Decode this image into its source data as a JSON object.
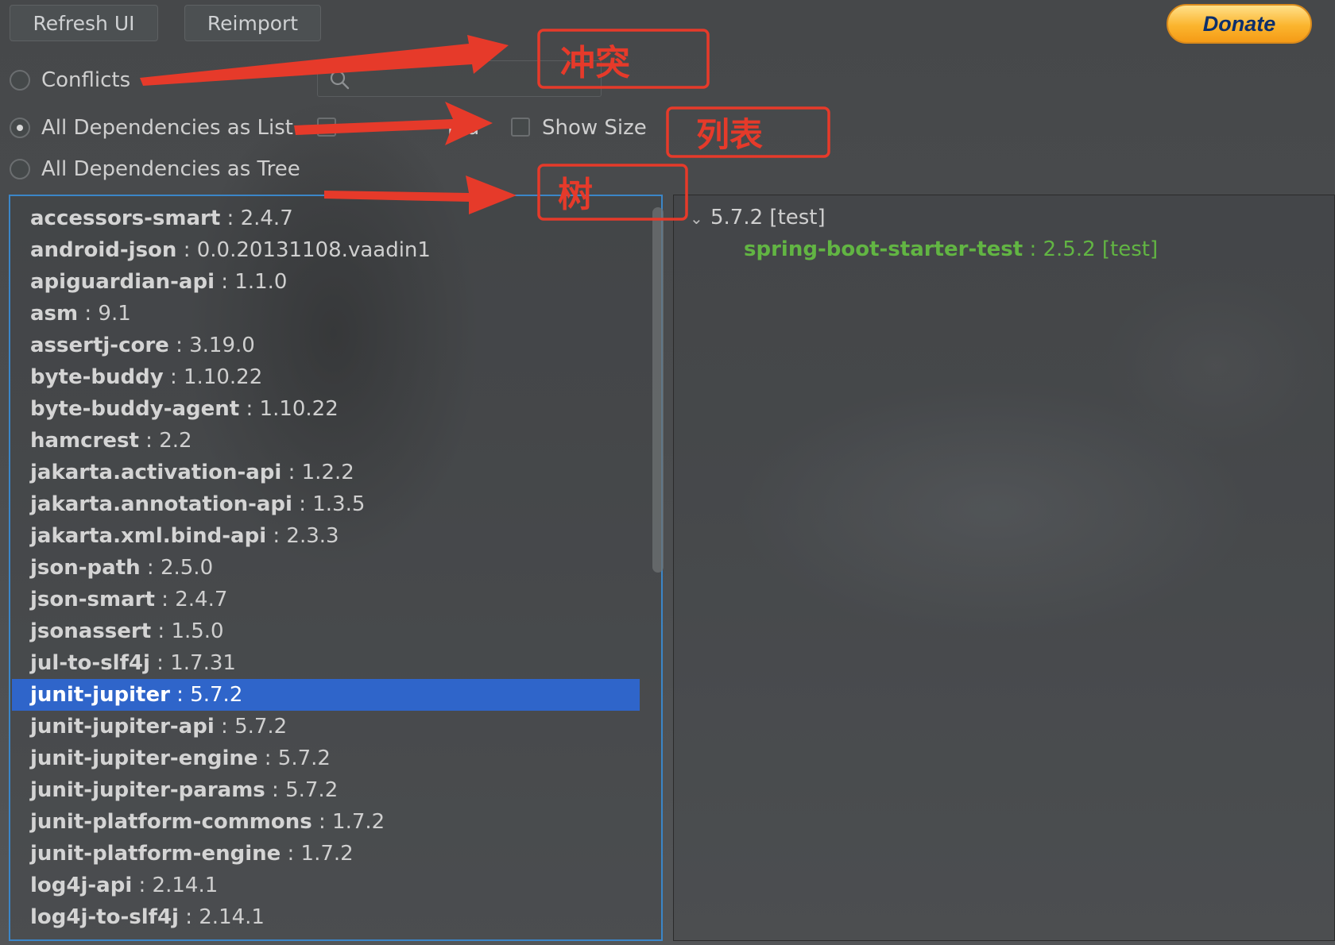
{
  "toolbar": {
    "refresh_label": "Refresh UI",
    "reimport_label": "Reimport",
    "donate_label": "Donate"
  },
  "modes": {
    "conflicts": "Conflicts",
    "list": "All Dependencies as List",
    "tree": "All Dependencies as Tree",
    "selected": "list"
  },
  "search": {
    "placeholder": "",
    "value": ""
  },
  "options": {
    "group_id_label_partial": "pid",
    "show_size_label": "Show Size"
  },
  "dependencies": [
    {
      "name": "accessors-smart",
      "version": "2.4.7"
    },
    {
      "name": "android-json",
      "version": "0.0.20131108.vaadin1"
    },
    {
      "name": "apiguardian-api",
      "version": "1.1.0"
    },
    {
      "name": "asm",
      "version": "9.1"
    },
    {
      "name": "assertj-core",
      "version": "3.19.0"
    },
    {
      "name": "byte-buddy",
      "version": "1.10.22"
    },
    {
      "name": "byte-buddy-agent",
      "version": "1.10.22"
    },
    {
      "name": "hamcrest",
      "version": "2.2"
    },
    {
      "name": "jakarta.activation-api",
      "version": "1.2.2"
    },
    {
      "name": "jakarta.annotation-api",
      "version": "1.3.5"
    },
    {
      "name": "jakarta.xml.bind-api",
      "version": "2.3.3"
    },
    {
      "name": "json-path",
      "version": "2.5.0"
    },
    {
      "name": "json-smart",
      "version": "2.4.7"
    },
    {
      "name": "jsonassert",
      "version": "1.5.0"
    },
    {
      "name": "jul-to-slf4j",
      "version": "1.7.31"
    },
    {
      "name": "junit-jupiter",
      "version": "5.7.2",
      "selected": true
    },
    {
      "name": "junit-jupiter-api",
      "version": "5.7.2"
    },
    {
      "name": "junit-jupiter-engine",
      "version": "5.7.2"
    },
    {
      "name": "junit-jupiter-params",
      "version": "5.7.2"
    },
    {
      "name": "junit-platform-commons",
      "version": "1.7.2"
    },
    {
      "name": "junit-platform-engine",
      "version": "1.7.2"
    },
    {
      "name": "log4j-api",
      "version": "2.14.1"
    },
    {
      "name": "log4j-to-slf4j",
      "version": "2.14.1"
    }
  ],
  "detail": {
    "root_label": "5.7.2 [test]",
    "child_name": "spring-boot-starter-test",
    "child_version": " : 2.5.2 [test]"
  },
  "annotations": {
    "conflicts_note": "冲突",
    "list_note": "列表",
    "tree_note": "树"
  },
  "colors": {
    "selection": "#2f65ca",
    "focus_border": "#3b86c8",
    "tree_child": "#62b543",
    "annotation": "#e63a2a"
  }
}
